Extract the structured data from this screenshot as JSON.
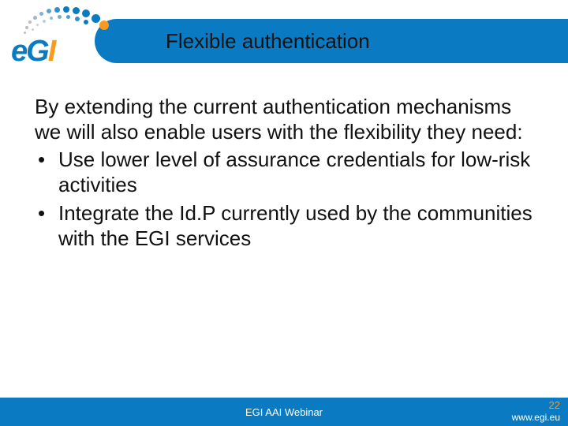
{
  "header": {
    "title": "Flexible authentication"
  },
  "logo": {
    "text_e": "e",
    "text_g": "G",
    "text_i": "I"
  },
  "body": {
    "intro": "By extending the current authentication mechanisms we will also enable users with the flexibility they need:",
    "bullets": [
      "Use lower level of assurance credentials for low-risk activities",
      "Integrate the Id.P currently used by the communities with the EGI services"
    ]
  },
  "footer": {
    "center": "EGI AAI Webinar",
    "page_number": "22",
    "url": "www.egi.eu"
  },
  "colors": {
    "brand_blue": "#0a7bc2",
    "accent_orange": "#f79a1e"
  }
}
